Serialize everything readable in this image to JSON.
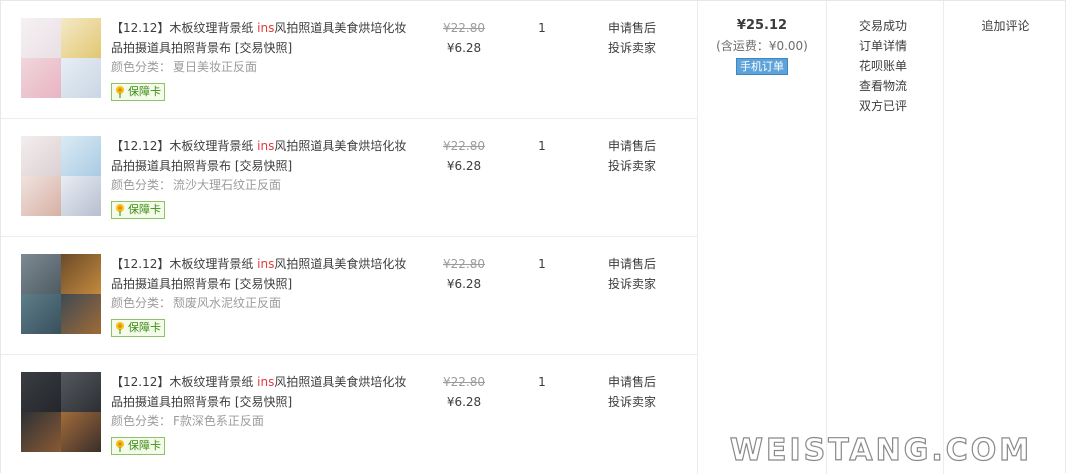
{
  "colors": {
    "text": "#3c3c3c",
    "muted": "#9c9c9c",
    "accent": "#e4393c",
    "badge_green": "#3a8d16"
  },
  "items": [
    {
      "title_prefix": "【12.12】木板纹理背景纸 ",
      "title_highlight": "ins",
      "title_rest": "风拍照道具美食烘培化妆品拍摄道具拍照背景布 [交易快照]",
      "sku_label": "颜色分类：",
      "sku_value": "夏日美妆正反面",
      "badge": "保障卡",
      "price_original": "¥22.80",
      "price_current": "¥6.28",
      "quantity": "1",
      "op_after_sales": "申请售后",
      "op_complain": "投诉卖家"
    },
    {
      "title_prefix": "【12.12】木板纹理背景纸 ",
      "title_highlight": "ins",
      "title_rest": "风拍照道具美食烘培化妆品拍摄道具拍照背景布 [交易快照]",
      "sku_label": "颜色分类：",
      "sku_value": "流沙大理石纹正反面",
      "badge": "保障卡",
      "price_original": "¥22.80",
      "price_current": "¥6.28",
      "quantity": "1",
      "op_after_sales": "申请售后",
      "op_complain": "投诉卖家"
    },
    {
      "title_prefix": "【12.12】木板纹理背景纸 ",
      "title_highlight": "ins",
      "title_rest": "风拍照道具美食烘培化妆品拍摄道具拍照背景布 [交易快照]",
      "sku_label": "颜色分类：",
      "sku_value": "颓废风水泥纹正反面",
      "badge": "保障卡",
      "price_original": "¥22.80",
      "price_current": "¥6.28",
      "quantity": "1",
      "op_after_sales": "申请售后",
      "op_complain": "投诉卖家"
    },
    {
      "title_prefix": "【12.12】木板纹理背景纸 ",
      "title_highlight": "ins",
      "title_rest": "风拍照道具美食烘培化妆品拍摄道具拍照背景布 [交易快照]",
      "sku_label": "颜色分类：",
      "sku_value": "F款深色系正反面",
      "badge": "保障卡",
      "price_original": "¥22.80",
      "price_current": "¥6.28",
      "quantity": "1",
      "op_after_sales": "申请售后",
      "op_complain": "投诉卖家"
    }
  ],
  "total": {
    "amount": "¥25.12",
    "shipping": "(含运费：¥0.00)",
    "mobile_tag": "手机订单"
  },
  "status": {
    "state": "交易成功",
    "order_detail": "订单详情",
    "huabei": "花呗账单",
    "logistics": "查看物流",
    "reviewed": "双方已评"
  },
  "action": {
    "add_review": "追加评论"
  },
  "watermark": "WEISTANG.COM"
}
